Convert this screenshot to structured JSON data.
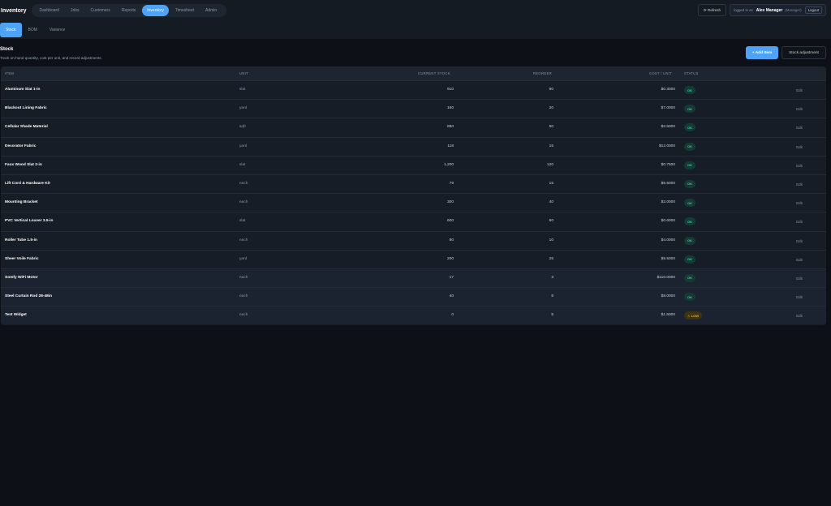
{
  "app_title": "Inventory",
  "nav": [
    "Dashboard",
    "Jobs",
    "Customers",
    "Reports",
    "Inventory",
    "Timesheet",
    "Admin"
  ],
  "nav_active": "Inventory",
  "header": {
    "refresh": "⟳ Refresh",
    "logged_in_as": "logged in as",
    "user_name": "Alex Manager",
    "user_role": "(Manager)",
    "logout": "Logout"
  },
  "subtabs": [
    "Stock",
    "BOM",
    "Variance"
  ],
  "subtab_active": "Stock",
  "section": {
    "title": "Stock",
    "subtitle": "Track on-hand quantity, cost per unit, and record adjustments.",
    "add_item": "+ Add Item",
    "stock_adjustment": "Stock adjustment"
  },
  "table": {
    "columns": [
      "ITEM",
      "UNIT",
      "CURRENT STOCK",
      "REORDER",
      "COST / UNIT",
      "STATUS"
    ],
    "edit_label": "Edit",
    "rows": [
      {
        "item": "Aluminum Slat 1-in",
        "unit": "slat",
        "stock": "910",
        "reorder": "90",
        "cost": "$0.3000",
        "status": "OK",
        "status_kind": "ok"
      },
      {
        "item": "Blackout Lining Fabric",
        "unit": "yard",
        "stock": "160",
        "reorder": "20",
        "cost": "$7.0000",
        "status": "OK",
        "status_kind": "ok"
      },
      {
        "item": "Cellular Shade Material",
        "unit": "sqft",
        "stock": "880",
        "reorder": "50",
        "cost": "$2.5000",
        "status": "OK",
        "status_kind": "ok"
      },
      {
        "item": "Decorator Fabric",
        "unit": "yard",
        "stock": "118",
        "reorder": "15",
        "cost": "$12.0000",
        "status": "OK",
        "status_kind": "ok"
      },
      {
        "item": "Faux Wood Slat 2-in",
        "unit": "slat",
        "stock": "1,200",
        "reorder": "120",
        "cost": "$0.7500",
        "status": "OK",
        "status_kind": "ok"
      },
      {
        "item": "Lift Cord & Hardware Kit",
        "unit": "each",
        "stock": "79",
        "reorder": "15",
        "cost": "$6.5000",
        "status": "OK",
        "status_kind": "ok"
      },
      {
        "item": "Mounting Bracket",
        "unit": "each",
        "stock": "300",
        "reorder": "40",
        "cost": "$2.0000",
        "status": "OK",
        "status_kind": "ok"
      },
      {
        "item": "PVC Vertical Louver 3.5-in",
        "unit": "slat",
        "stock": "600",
        "reorder": "60",
        "cost": "$0.6000",
        "status": "OK",
        "status_kind": "ok"
      },
      {
        "item": "Roller Tube 1.5-in",
        "unit": "each",
        "stock": "80",
        "reorder": "10",
        "cost": "$4.0000",
        "status": "OK",
        "status_kind": "ok"
      },
      {
        "item": "Sheer Voile Fabric",
        "unit": "yard",
        "stock": "200",
        "reorder": "25",
        "cost": "$5.5000",
        "status": "OK",
        "status_kind": "ok"
      },
      {
        "item": "Somfy WiFi Motor",
        "unit": "each",
        "stock": "17",
        "reorder": "3",
        "cost": "$110.0000",
        "status": "OK",
        "status_kind": "ok"
      },
      {
        "item": "Steel Curtain Rod 28-48in",
        "unit": "each",
        "stock": "40",
        "reorder": "8",
        "cost": "$8.0000",
        "status": "OK",
        "status_kind": "ok"
      },
      {
        "item": "Test Widget",
        "unit": "each",
        "stock": "0",
        "reorder": "5",
        "cost": "$1.5000",
        "status": "⚠ LOW",
        "status_kind": "low"
      }
    ]
  },
  "colors": {
    "accent": "#4fa3f7",
    "ok_text": "#3fc69b",
    "low_text": "#e3b341"
  }
}
